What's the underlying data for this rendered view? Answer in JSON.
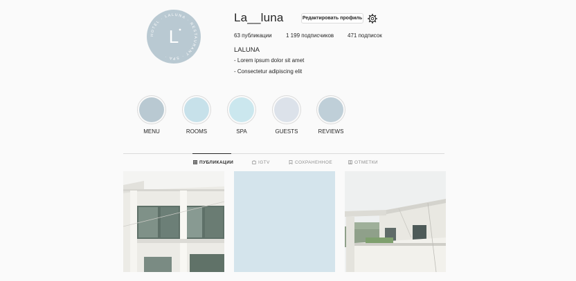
{
  "profile": {
    "username": "La__luna",
    "edit_button": "Редактировать профиль",
    "stats": {
      "posts_count": "63",
      "posts_label": "публикации",
      "followers_count": "1 199",
      "followers_label": "подписчиков",
      "following_count": "471",
      "following_label": "подписок"
    },
    "bio": {
      "name": "LALUNA",
      "line1": "- Lorem ipsum dolor sit amet",
      "line2": "- Consectetur adipiscing elit"
    },
    "avatar_letter": "L",
    "avatar_ring_text": "HOTEL · LALUNA · RESTAURANT · SPA ·"
  },
  "highlights": [
    {
      "label": "MENU",
      "color": "#b9c9d2"
    },
    {
      "label": "ROOMS",
      "color": "#c7e1ea"
    },
    {
      "label": "SPA",
      "color": "#cbe7ee"
    },
    {
      "label": "GUESTS",
      "color": "#dce2ea"
    },
    {
      "label": "REVIEWS",
      "color": "#bfcfd8"
    }
  ],
  "tabs": [
    {
      "label": "ПУБЛИКАЦИИ",
      "icon": "grid-icon",
      "active": true
    },
    {
      "label": "IGTV",
      "icon": "igtv-icon",
      "active": false
    },
    {
      "label": "СОХРАНЕННОЕ",
      "icon": "bookmark-icon",
      "active": false
    },
    {
      "label": "ОТМЕТКИ",
      "icon": "tag-icon",
      "active": false
    }
  ],
  "posts": [
    {
      "kind": "photo",
      "subject": "hotel-building-facade"
    },
    {
      "kind": "placeholder",
      "color": "#d4e4ec"
    },
    {
      "kind": "photo",
      "subject": "hotel-building-balcony"
    }
  ],
  "colors": {
    "background": "#fafafa",
    "border": "#dbdbdb",
    "text": "#262626",
    "muted": "#8e8e8e"
  }
}
